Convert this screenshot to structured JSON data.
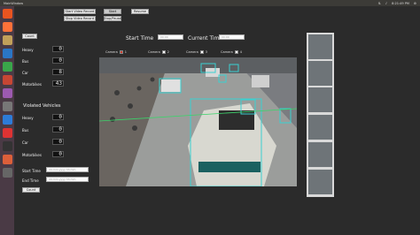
{
  "topbar": {
    "title": "MainWindow",
    "clock": "8:21:49 PM"
  },
  "controls": {
    "start_record": "Start Video Record",
    "stop_record": "Stop Video Record",
    "start": "Start",
    "stop_pause": "Stop/Pause",
    "resume": "Resume"
  },
  "counts_panel": {
    "count_button": "Count",
    "rows": [
      {
        "label": "Heavy",
        "value": "0"
      },
      {
        "label": "Bus",
        "value": "0"
      },
      {
        "label": "Car",
        "value": "8"
      },
      {
        "label": "Motorbikes",
        "value": "43"
      }
    ]
  },
  "violated": {
    "title": "Violated Vehicles",
    "rows": [
      {
        "label": "Heavy",
        "value": "0"
      },
      {
        "label": "Bus",
        "value": "0"
      },
      {
        "label": "Car",
        "value": "0"
      },
      {
        "label": "Motorbikes",
        "value": "0"
      }
    ]
  },
  "time_filter": {
    "start_label": "Start Time",
    "end_label": "End Time",
    "start_placeholder": "dd-mm-yyyy hh:mm",
    "end_placeholder": "dd-mm-yyyy hh:mm",
    "count_button": "Count"
  },
  "header_time": {
    "start_label": "Start Time",
    "current_label": "Current Time",
    "start_value": "00:00",
    "current_value": "00:00"
  },
  "cameras": [
    {
      "label": "Camera",
      "num": "1",
      "on": true
    },
    {
      "label": "Camera",
      "num": "2",
      "on": false
    },
    {
      "label": "Camera",
      "num": "3",
      "on": false
    },
    {
      "label": "Camera",
      "num": "4",
      "on": false
    }
  ],
  "colors": {
    "accent": "#d23b2b",
    "detection": "#3ad1d1",
    "line": "#3bd46a"
  }
}
